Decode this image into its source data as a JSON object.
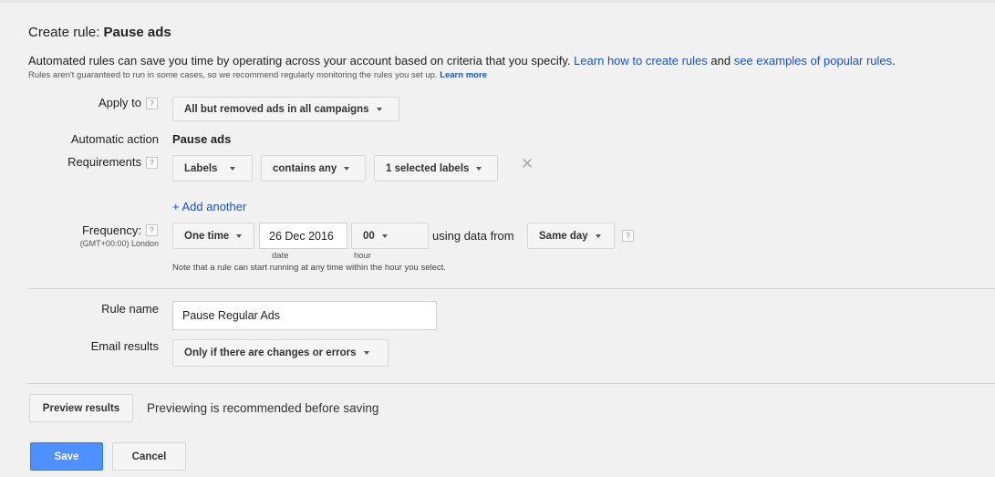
{
  "header": {
    "title_prefix": "Create rule: ",
    "title_name": "Pause ads"
  },
  "intro": {
    "text": "Automated rules can save you time by operating across your account based on criteria that you specify. ",
    "link1": "Learn how to create rules",
    "mid": " and ",
    "link2": "see examples of popular rules",
    "end": ".",
    "note": "Rules aren't guaranteed to run in some cases, so we recommend regularly monitoring the rules you set up. ",
    "note_link": "Learn more"
  },
  "help_glyph": "?",
  "apply_to": {
    "label": "Apply to",
    "value": "All but removed ads in all campaigns"
  },
  "automatic_action": {
    "label": "Automatic action",
    "value": "Pause ads"
  },
  "requirements": {
    "label": "Requirements",
    "field": "Labels",
    "operator": "contains any",
    "selection": "1 selected labels",
    "remove_glyph": "✕",
    "add_another": "+ Add another"
  },
  "frequency": {
    "label": "Frequency:",
    "timezone": "(GMT+00:00) London",
    "mode": "One time",
    "date": "26 Dec 2016",
    "date_caption": "date",
    "hour": "00",
    "hour_caption": "hour",
    "using_text": "using data from",
    "data_range": "Same day",
    "note": "Note that a rule can start running at any time within the hour you select."
  },
  "rule_name": {
    "label": "Rule name",
    "value": "Pause Regular Ads"
  },
  "email_results": {
    "label": "Email results",
    "value": "Only if there are changes or errors"
  },
  "preview": {
    "button": "Preview results",
    "message": "Previewing is recommended before saving"
  },
  "actions": {
    "save": "Save",
    "cancel": "Cancel"
  }
}
